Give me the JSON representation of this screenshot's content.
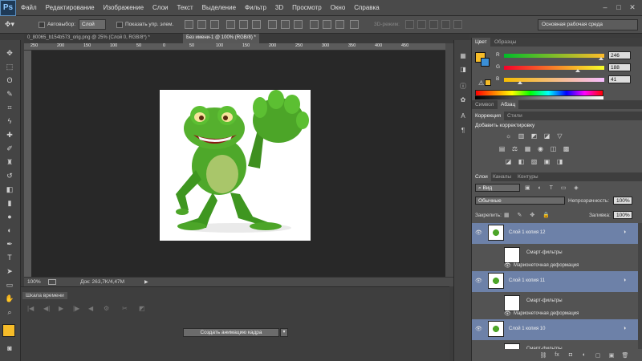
{
  "app": {
    "logo": "Ps"
  },
  "menu": [
    "Файл",
    "Редактирование",
    "Изображение",
    "Слои",
    "Текст",
    "Выделение",
    "Фильтр",
    "3D",
    "Просмотр",
    "Окно",
    "Справка"
  ],
  "window_controls": {
    "minimize": "–",
    "restore": "□",
    "close": "✕"
  },
  "options_bar": {
    "autoselect_label": "Автовыбор:",
    "autoselect_value": "Слой",
    "show_controls_label": "Показать упр. элем.",
    "mode_3d_label": "3D-режим:",
    "workspace": "Основная рабочая среда"
  },
  "doc_tabs": [
    {
      "label": "0_80065_b154b573_orig.png @ 25% (Слой 0, RGB/8*) *",
      "active": false
    },
    {
      "label": "Без имени-1 @ 100% (RGB/8) *",
      "active": true
    }
  ],
  "ruler_ticks": [
    "250",
    "200",
    "150",
    "100",
    "50",
    "0",
    "50",
    "100",
    "150",
    "200",
    "250",
    "300",
    "350",
    "400",
    "450"
  ],
  "status": {
    "zoom": "100%",
    "doc_info": "Док: 263,7K/4,47M"
  },
  "timeline": {
    "title": "Шкала времени",
    "create_button": "Создать анимацию кадра",
    "dropdown_arrow": "▾"
  },
  "color_panel": {
    "tabs": [
      "Цвет",
      "Образцы"
    ],
    "channels": [
      {
        "letter": "R",
        "value": "246",
        "fraction": 0.965,
        "gradient": [
          "#00bc29",
          "#ffbc29"
        ]
      },
      {
        "letter": "G",
        "value": "188",
        "fraction": 0.737,
        "gradient": [
          "#f60029",
          "#f6ff29"
        ]
      },
      {
        "letter": "B",
        "value": "41",
        "fraction": 0.161,
        "gradient": [
          "#f6bc00",
          "#f6bcff"
        ]
      }
    ],
    "foreground": "#f6bc29",
    "background": "#3b8fd6"
  },
  "char_tabs": [
    "Символ",
    "Абзац"
  ],
  "adjust_panel": {
    "tabs": [
      "Коррекция",
      "Стили"
    ],
    "heading": "Добавить корректировку",
    "icons_row1": [
      "☼",
      "▥",
      "◩",
      "◪",
      "▽"
    ],
    "icons_row2": [
      "▤",
      "⚖",
      "▦",
      "◉",
      "◫",
      "▩"
    ],
    "icons_row3": [
      "◪",
      "◧",
      "▨",
      "▣",
      "◨"
    ]
  },
  "layers_panel": {
    "tabs": [
      "Слои",
      "Каналы",
      "Контуры"
    ],
    "filter_kind": "Вид",
    "blend_mode": "Обычные",
    "opacity_label": "Непрозрачность:",
    "opacity_value": "100%",
    "lock_label": "Закрепить:",
    "fill_label": "Заливка:",
    "fill_value": "100%",
    "layers": [
      {
        "name": "Слой 1 копия 12",
        "sub": [
          "Смарт-фильтры",
          "Марионеточная деформация"
        ]
      },
      {
        "name": "Слой 1 копия 11",
        "sub": [
          "Смарт-фильтры",
          "Марионеточная деформация"
        ]
      },
      {
        "name": "Слой 1 копия 10",
        "sub": [
          "Смарт-фильтры"
        ]
      }
    ],
    "bottom_icons": [
      "⛓",
      "fx",
      "◘",
      "◐",
      "▢",
      "▣",
      "🗑"
    ]
  },
  "colors": {
    "accent_selected": "#6d81a8",
    "canvas_bg": "#282828",
    "panel_bg": "#535353"
  }
}
